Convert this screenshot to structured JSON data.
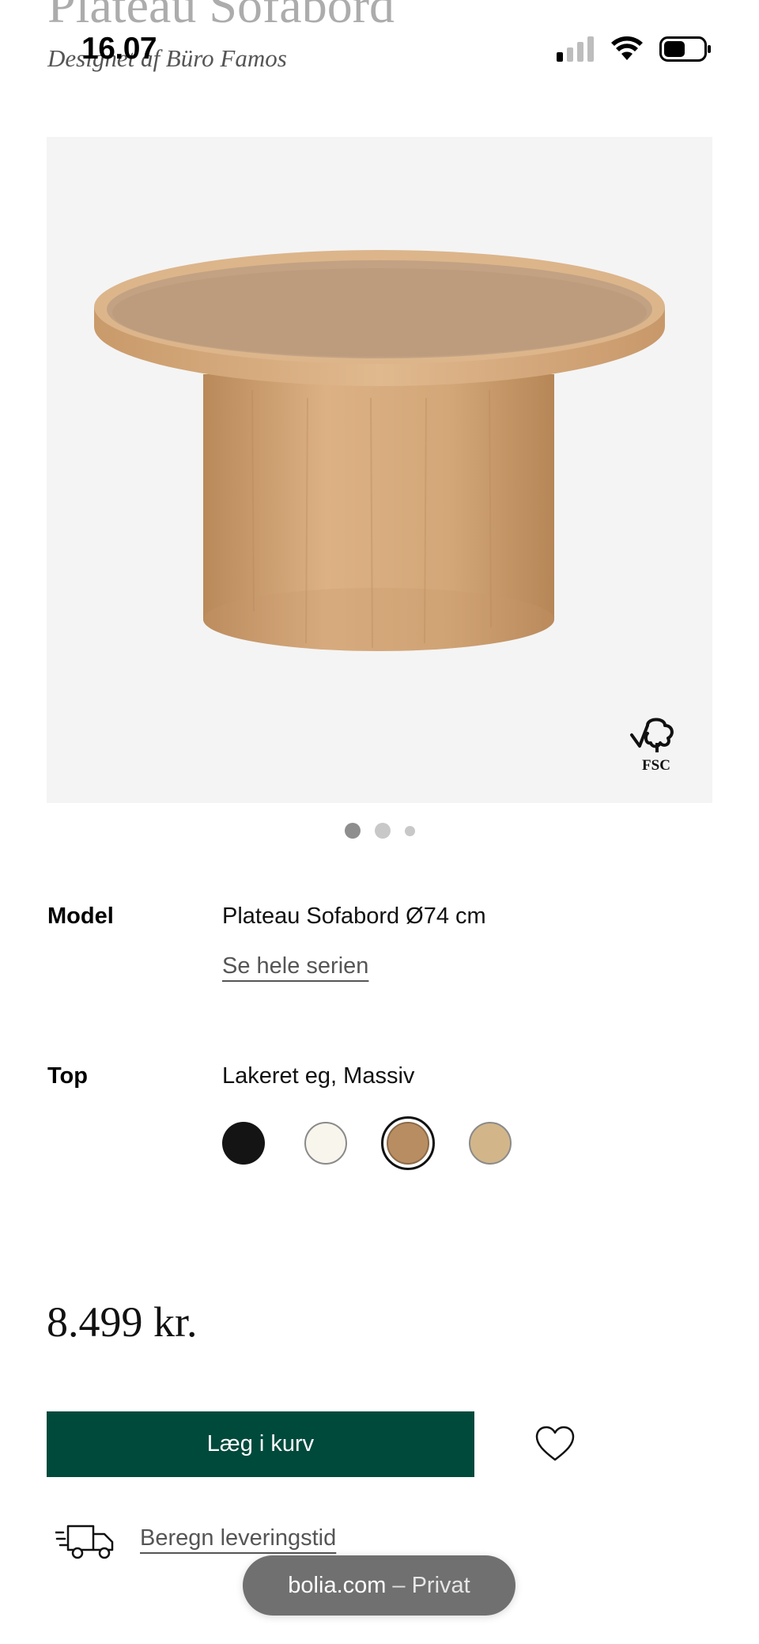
{
  "header": {
    "title_peek": "Plateau Sofabord",
    "designer": "Designet af Büro Famos"
  },
  "status_bar": {
    "time": "16.07",
    "icons": [
      "signal-icon",
      "wifi-icon",
      "battery-icon"
    ]
  },
  "gallery": {
    "badge_text": "FSC",
    "dots": 3,
    "active_dot": 0
  },
  "specs": {
    "model": {
      "label": "Model",
      "value": "Plateau Sofabord Ø74 cm",
      "link": "Se hele serien"
    },
    "top": {
      "label": "Top",
      "value": "Lakeret eg, Massiv",
      "swatches": [
        {
          "name": "black",
          "color": "#141414",
          "selected": false
        },
        {
          "name": "white",
          "color": "#f8f5ec",
          "selected": false
        },
        {
          "name": "oak",
          "color": "#b98d62",
          "selected": true
        },
        {
          "name": "light-oak",
          "color": "#d2b68a",
          "selected": false
        }
      ]
    }
  },
  "price": "8.499 kr.",
  "actions": {
    "add_to_cart": "Læg i kurv",
    "favorite_icon": "heart-icon",
    "delivery_link": "Beregn leveringstid",
    "delivery_icon": "truck-icon"
  },
  "browser_pill": {
    "domain": "bolia.com",
    "separator": "–",
    "mode": "Privat"
  },
  "colors": {
    "primary_button": "#004a3c",
    "image_background": "#f4f4f4",
    "pill_background": "#707070"
  }
}
